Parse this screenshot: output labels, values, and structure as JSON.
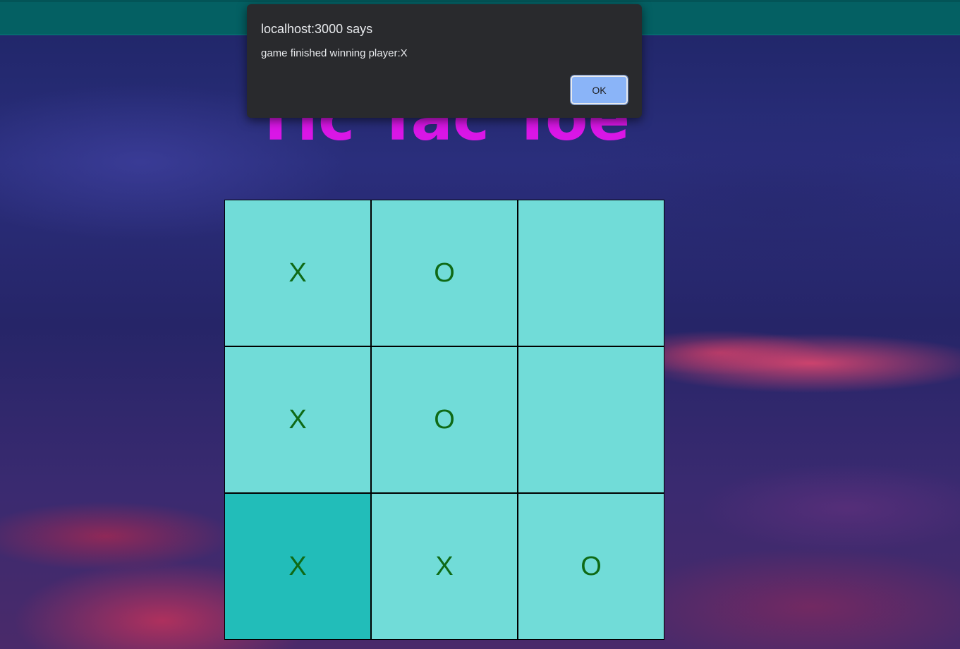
{
  "page": {
    "title": "Tic Tac Toe",
    "title_color": "#d916e6",
    "topbar_color": "#046063"
  },
  "board": {
    "cell_color": "#71dcd8",
    "hover_cell_color": "#22bdb9",
    "mark_color": "#0f6a16",
    "cells": [
      "X",
      "O",
      "",
      "X",
      "O",
      "",
      "X",
      "X",
      "O"
    ],
    "highlighted_cell_index": 6
  },
  "alert": {
    "title": "localhost:3000 says",
    "message": "game finished winning player:X",
    "ok_label": "OK",
    "button_color": "#8ab4f8",
    "background_color": "#292a2d"
  }
}
